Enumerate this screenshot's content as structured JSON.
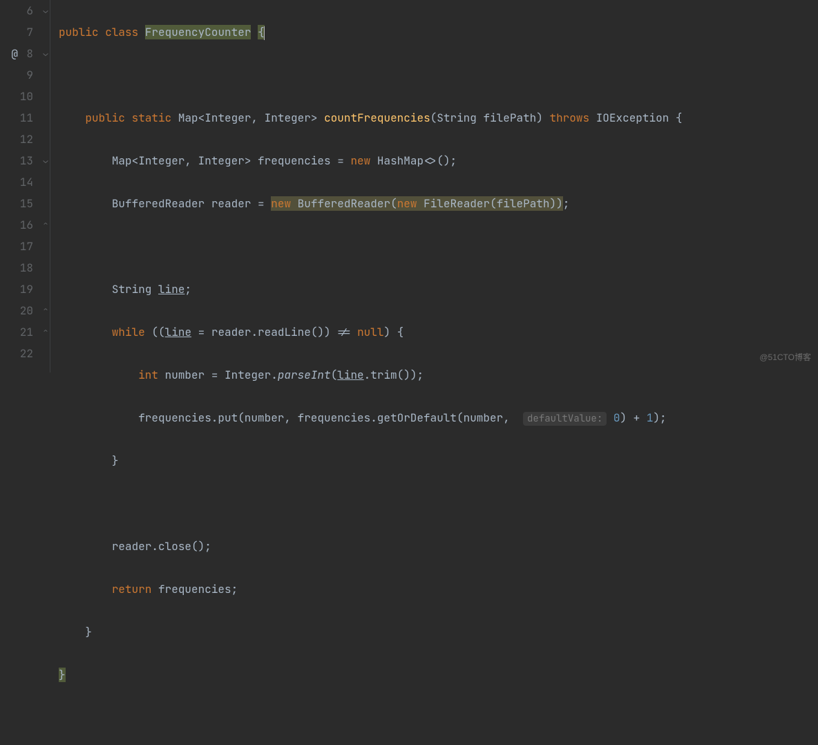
{
  "lines": {
    "start": 6,
    "end": 22,
    "numbers": [
      "6",
      "7",
      "8",
      "9",
      "10",
      "11",
      "12",
      "13",
      "14",
      "15",
      "16",
      "17",
      "18",
      "19",
      "20",
      "21",
      "22"
    ]
  },
  "gutter_icons": {
    "line8": "@"
  },
  "fold_marks": {
    "line6": "⌄",
    "line8": "⌄",
    "line13": "⌄",
    "line16": "⌃",
    "line20": "⌃",
    "line21": "⌃"
  },
  "code": {
    "l6": {
      "kw_public": "public",
      "kw_class": "class",
      "class_name": "FrequencyCounter",
      "brace": "{"
    },
    "l8": {
      "kw_public": "public",
      "kw_static": "static",
      "ret_type": "Map<Integer, Integer>",
      "method": "countFrequencies",
      "params": "(String filePath)",
      "kw_throws": "throws",
      "exc": "IOException",
      "brace": "{"
    },
    "l9": {
      "decl_type": "Map<Integer, Integer>",
      "var": "frequencies",
      "eq": " = ",
      "kw_new": "new",
      "ctor": "HashMap<>()",
      "semi": ";"
    },
    "l10": {
      "decl_type": "BufferedReader",
      "var": "reader",
      "eq": " = ",
      "kw_new1": "new",
      "ctor1": "BufferedReader(",
      "kw_new2": "new",
      "ctor2": "FileReader(filePath))",
      "semi": ";"
    },
    "l12": {
      "decl_type": "String",
      "var": "line",
      "semi": ";"
    },
    "l13": {
      "kw_while": "while",
      "open": " ((",
      "var": "line",
      "rest": " = reader.readLine()) != ",
      "kw_null": "null",
      "close": ") {"
    },
    "l14": {
      "kw_int": "int",
      "var": " number = Integer.",
      "parse": "parseInt",
      "open": "(",
      "line_var": "line",
      "trim": ".trim());"
    },
    "l15": {
      "pre": "frequencies.put(number, frequencies.getOrDefault(number, ",
      "hint": "defaultValue:",
      "zero": "0",
      "post": ") + ",
      "one": "1",
      "end": ");"
    },
    "l16": {
      "brace": "}"
    },
    "l18": {
      "text": "reader.close();"
    },
    "l19": {
      "kw_return": "return",
      "rest": " frequencies;"
    },
    "l20": {
      "brace": "}"
    },
    "l21": {
      "brace": "}"
    }
  },
  "watermark": "@51CTO博客"
}
